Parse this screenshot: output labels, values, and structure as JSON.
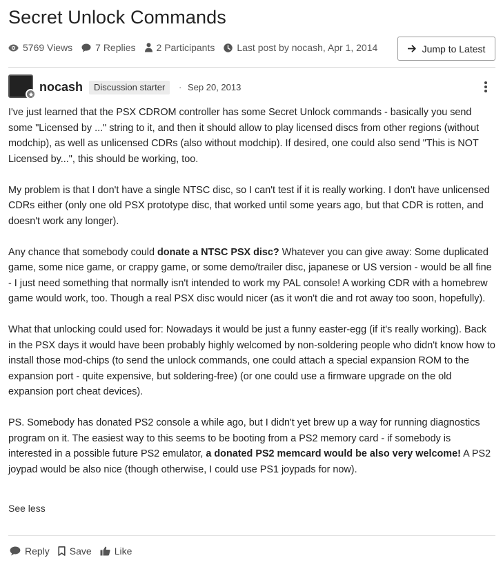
{
  "thread": {
    "title": "Secret Unlock Commands",
    "views": "5769 Views",
    "replies": "7 Replies",
    "participants": "2 Participants",
    "last_post": "Last post by nocash, Apr 1, 2014",
    "jump_label": "Jump to Latest"
  },
  "post": {
    "author": "nocash",
    "role": "Discussion starter",
    "separator": "·",
    "date": "Sep 20, 2013",
    "p1": "I've just learned that the PSX CDROM controller has some Secret Unlock commands - basically you send some \"Licensed by ...\" string to it, and then it should allow to play licensed discs from other regions (without modchip), as well as unlicensed CDRs (also without modchip). If desired, one could also send \"This is NOT Licensed by...\", this should be working, too.",
    "p2": "My problem is that I don't have a single NTSC disc, so I can't test if it is really working. I don't have unlicensed CDRs either (only one old PSX prototype disc, that worked until some years ago, but that CDR is rotten, and doesn't work any longer).",
    "p3a": "Any chance that somebody could ",
    "p3b": "donate a NTSC PSX disc?",
    "p3c": " Whatever you can give away: Some duplicated game, some nice game, or crappy game, or some demo/trailer disc, japanese or US version - would be all fine - I just need something that normally isn't intended to work my PAL console! A working CDR with a homebrew game would work, too. Though a real PSX disc would nicer (as it won't die and rot away too soon, hopefully).",
    "p4": "What that unlocking could used for: Nowadays it would be just a funny easter-egg (if it's really working). Back in the PSX days it would have been probably highly welcomed by non-soldering people who didn't know how to install those mod-chips (to send the unlock commands, one could attach a special expansion ROM to the expansion port - quite expensive, but soldering-free) (or one could use a firmware upgrade on the old expansion port cheat devices).",
    "p5a": "PS. Somebody has donated PS2 console a while ago, but I didn't yet brew up a way for running diagnostics program on it. The easiest way to this seems to be booting from a PS2 memory card - if somebody is interested in a possible future PS2 emulator, ",
    "p5b": "a donated PS2 memcard would be also very welcome!",
    "p5c": " A PS2 joypad would be also nice (though otherwise, I could use PS1 joypads for now).",
    "see_less": "See less"
  },
  "actions": {
    "reply": "Reply",
    "save": "Save",
    "like": "Like"
  },
  "colors": {
    "text": "#222222",
    "muted": "#555555",
    "badge_bg": "#ececec",
    "divider": "#d9d9d9"
  },
  "icons": [
    "eye-icon",
    "speech-bubble-icon",
    "person-icon",
    "clock-icon",
    "arrow-right-icon",
    "star-badge-icon",
    "kebab-menu-icon",
    "reply-bubble-icon",
    "bookmark-icon",
    "thumbs-up-icon"
  ]
}
